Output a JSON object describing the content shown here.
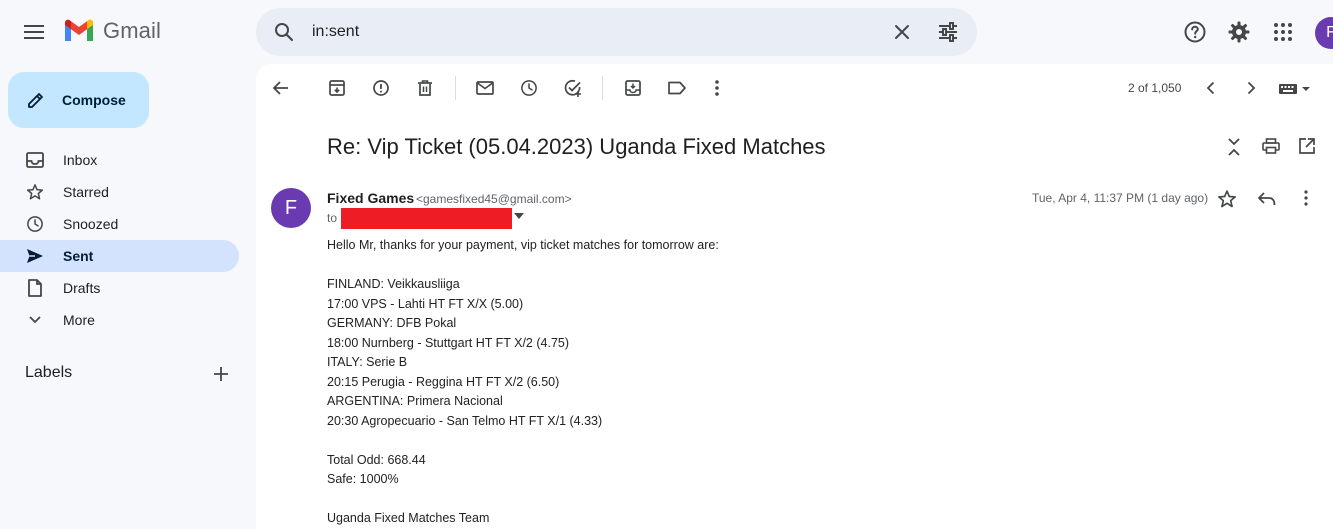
{
  "app": {
    "name": "Gmail"
  },
  "search": {
    "value": "in:sent"
  },
  "user": {
    "avatar_letter": "F"
  },
  "nav": {
    "compose_label": "Compose",
    "items": [
      {
        "label": "Inbox",
        "icon": "inbox-icon"
      },
      {
        "label": "Starred",
        "icon": "star-icon"
      },
      {
        "label": "Snoozed",
        "icon": "clock-icon"
      },
      {
        "label": "Sent",
        "icon": "send-icon",
        "active": true
      },
      {
        "label": "Drafts",
        "icon": "draft-icon"
      },
      {
        "label": "More",
        "icon": "chevron-down-icon"
      }
    ],
    "labels_title": "Labels"
  },
  "toolbar": {
    "pager": "2 of 1,050"
  },
  "email": {
    "subject": "Re: Vip Ticket (05.04.2023) Uganda Fixed Matches",
    "sender_initial": "F",
    "sender_name": "Fixed Games",
    "sender_email": "<gamesfixed45@gmail.com>",
    "to_label": "to",
    "date": "Tue, Apr 4, 11:37 PM (1 day ago)",
    "body_lines": [
      "Hello Mr, thanks for your payment, vip ticket matches for tomorrow are:",
      "",
      "FINLAND: Veikkausliiga",
      "17:00 VPS - Lahti HT FT X/X (5.00)",
      "GERMANY: DFB Pokal",
      "18:00 Nurnberg - Stuttgart HT FT X/2 (4.75)",
      "ITALY: Serie B",
      "20:15 Perugia - Reggina HT FT X/2 (6.50)",
      "ARGENTINA: Primera Nacional",
      "20:30 Agropecuario - San Telmo HT FT X/1 (4.33)",
      "",
      "Total Odd: 668.44",
      "Safe: 1000%",
      "",
      "Uganda Fixed Matches Team"
    ]
  },
  "colors": {
    "accent_avatar": "#6a3bb0",
    "compose_bg": "#c2e7ff",
    "nav_active_bg": "#d3e3fd",
    "redaction": "#ee1c24"
  }
}
